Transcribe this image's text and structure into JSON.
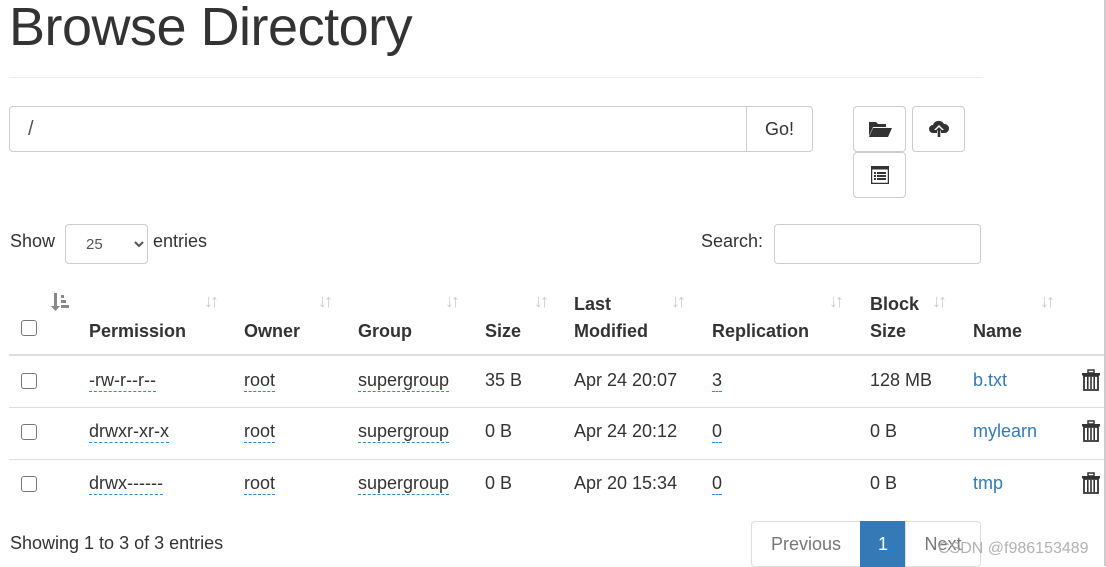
{
  "title": "Browse Directory",
  "path": {
    "value": "/",
    "go_label": "Go!"
  },
  "toolbar": {
    "icons": [
      "folder-open-icon",
      "cloud-upload-icon",
      "list-icon"
    ]
  },
  "show": {
    "prefix": "Show",
    "value": "25",
    "suffix": "entries"
  },
  "search": {
    "label": "Search:",
    "value": ""
  },
  "columns": [
    "Permission",
    "Owner",
    "Group",
    "Size",
    "Last",
    "Modified",
    "Replication",
    "Block",
    "Size",
    "Name"
  ],
  "rows": [
    {
      "permission": "-rw-r--r--",
      "owner": "root",
      "group": "supergroup",
      "size": "35 B",
      "modified": "Apr 24 20:07",
      "replication": "3",
      "block_size": "128 MB",
      "name": "b.txt"
    },
    {
      "permission": "drwxr-xr-x",
      "owner": "root",
      "group": "supergroup",
      "size": "0 B",
      "modified": "Apr 24 20:12",
      "replication": "0",
      "block_size": "0 B",
      "name": "mylearn"
    },
    {
      "permission": "drwx------",
      "owner": "root",
      "group": "supergroup",
      "size": "0 B",
      "modified": "Apr 20 15:34",
      "replication": "0",
      "block_size": "0 B",
      "name": "tmp"
    }
  ],
  "footer": {
    "info": "Showing 1 to 3 of 3 entries",
    "previous": "Previous",
    "page": "1",
    "next": "Next"
  },
  "watermark": "CSDN @f986153489",
  "colors": {
    "accent": "#337ab7",
    "link": "#337ab7"
  }
}
